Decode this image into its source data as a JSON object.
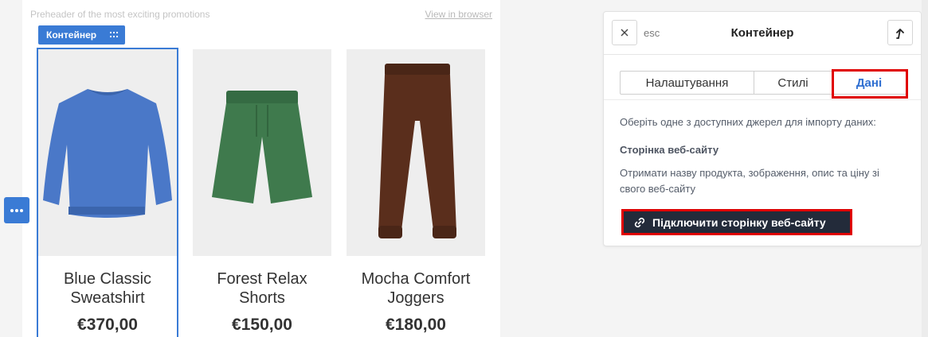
{
  "email": {
    "preheader": "Preheader of the most exciting promotions",
    "view_in_browser": "View in browser",
    "container_tag": "Контейнер",
    "products": [
      {
        "name": "Blue Classic Sweatshirt",
        "price": "€370,00",
        "image": "sweatshirt-image",
        "color": "#4a78c8"
      },
      {
        "name": "Forest Relax Shorts",
        "price": "€150,00",
        "image": "shorts-image",
        "color": "#3f7a4d"
      },
      {
        "name": "Mocha Comfort Joggers",
        "price": "€180,00",
        "image": "joggers-image",
        "color": "#5a2e1c"
      }
    ]
  },
  "panel": {
    "close_icon": "close-icon",
    "esc_label": "esc",
    "title": "Контейнер",
    "tabs": [
      {
        "label": "Налаштування",
        "active": false
      },
      {
        "label": "Стилі",
        "active": false
      },
      {
        "label": "Дані",
        "active": true
      }
    ],
    "intro": "Оберіть одне з доступних джерел для імпорту даних:",
    "section_title": "Сторінка веб-сайту",
    "description": "Отримати назву продукта, зображення, опис та ціну зі свого веб-сайту",
    "connect_button": "Підключити сторінку веб-сайту"
  },
  "colors": {
    "accent": "#3a7bd5",
    "highlight": "#e00000",
    "button_dark": "#232b3a",
    "active_tab": "#2f6fd1"
  }
}
